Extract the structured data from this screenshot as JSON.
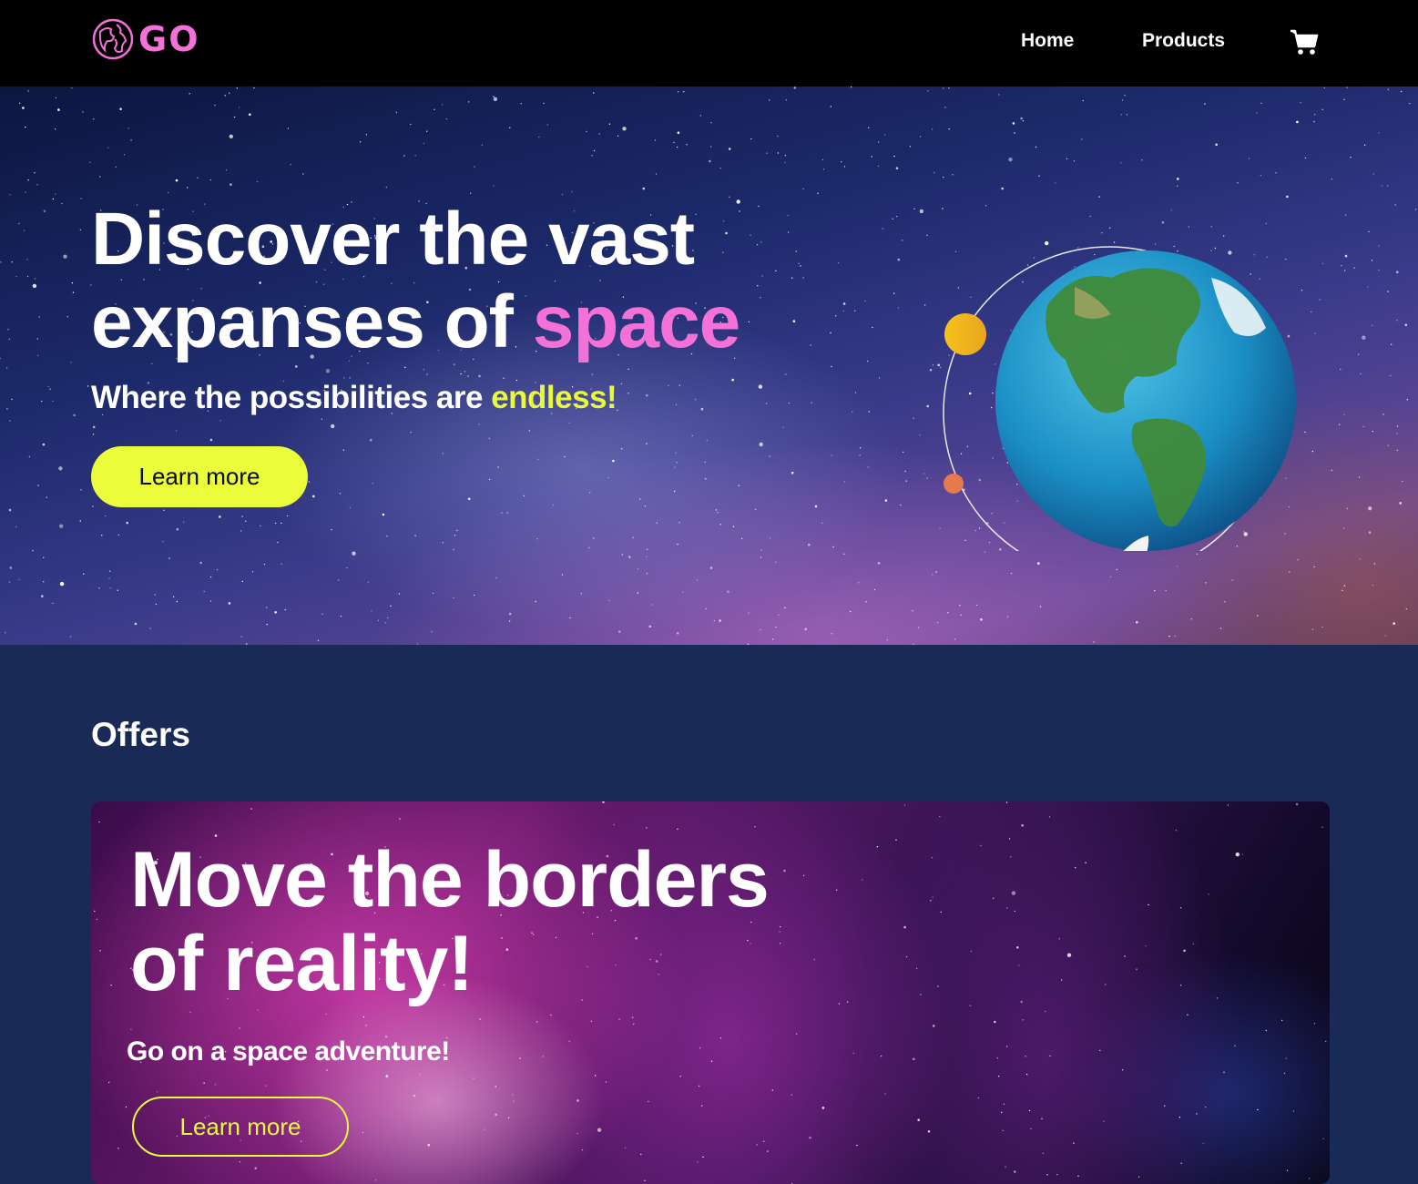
{
  "brand": {
    "name": "GO",
    "color": "#f471d8",
    "icon": "globe-icon"
  },
  "nav": {
    "home": "Home",
    "products": "Products",
    "cart_icon": "cart-icon"
  },
  "hero": {
    "title_part1": "Discover the vast expanses of ",
    "title_accent": "space",
    "subtitle_part1": "Where the possibilities are ",
    "subtitle_accent": "endless!",
    "button": "Learn more",
    "accent_pink": "#f471d8",
    "accent_yellow": "#eafc3a"
  },
  "offers": {
    "heading": "Offers",
    "card": {
      "title": "Move the borders of reality!",
      "subtitle": "Go on a space adventure!",
      "button": "Learn more"
    }
  }
}
